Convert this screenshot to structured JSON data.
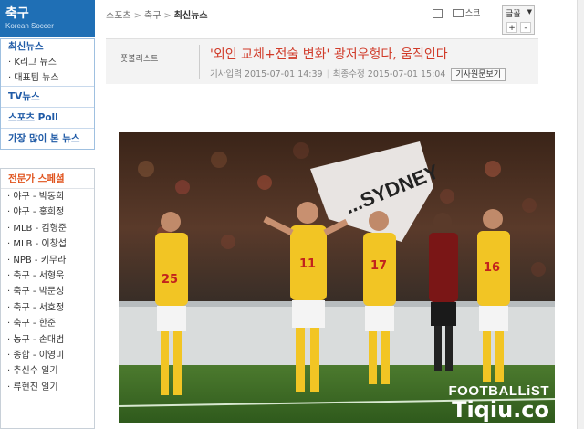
{
  "brand": {
    "title": "축구",
    "subtitle": "Korean Soccer"
  },
  "menu": {
    "latest": "최신뉴스",
    "kleague": "· K리그 뉴스",
    "national": "· 대표팀 뉴스",
    "tv": "TV뉴스",
    "poll": "스포츠 Poll",
    "most_read": "가장 많이 본 뉴스"
  },
  "experts": {
    "heading": "전문가 스페셜",
    "items": [
      "· 야구 - 박동희",
      "· 야구 - 홍희정",
      "· MLB - 김형준",
      "· MLB - 이창섭",
      "· NPB - 키무라",
      "· 축구 - 서형욱",
      "· 축구 - 박문성",
      "· 축구 - 서호정",
      "· 축구 - 한준",
      "· 농구 - 손대범",
      "· 종합 - 이영미",
      "· 추신수 일기",
      "· 류현진 일기"
    ]
  },
  "breadcrumb": {
    "root": "스포츠",
    "section": "축구",
    "current": "최신뉴스"
  },
  "tools": {
    "scrap": "스크",
    "font_label": "글꼴",
    "plus": "+",
    "minus": "-"
  },
  "article": {
    "provider": "풋볼리스트",
    "title": "'외인 교체+전술 변화' 광저우헝다, 움직인다",
    "published": "기사입력 2015-07-01 14:39",
    "modified": "최종수정 2015-07-01 15:04",
    "original_button": "기사원문보기"
  },
  "photo": {
    "banner_text": "...SYDNEY",
    "jersey_numbers": [
      "25",
      "11",
      "17",
      "16"
    ],
    "watermark_line1": "FOOTBALLiST",
    "watermark_line2": "Tiqiu.co"
  }
}
